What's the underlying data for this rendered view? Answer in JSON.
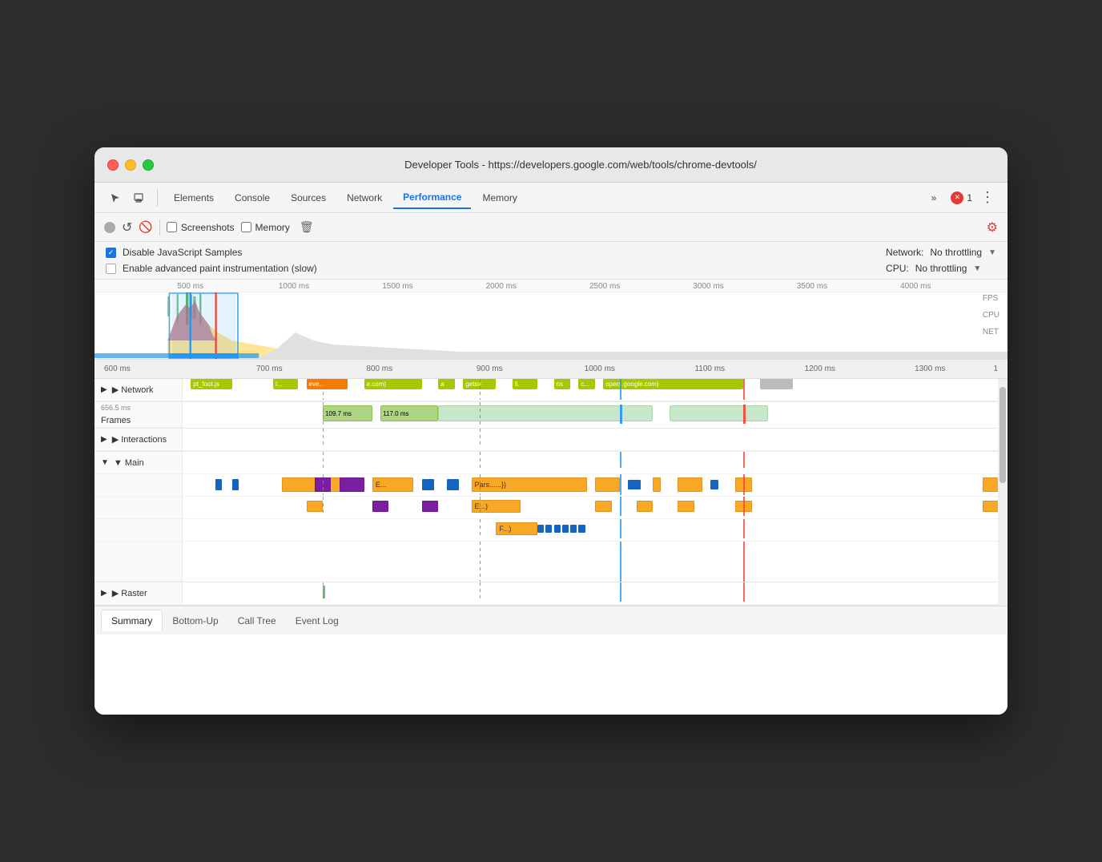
{
  "window": {
    "title": "Developer Tools - https://developers.google.com/web/tools/chrome-devtools/"
  },
  "tabs": {
    "items": [
      "Elements",
      "Console",
      "Sources",
      "Network",
      "Performance",
      "Memory"
    ],
    "active": "Performance",
    "more_label": "»",
    "error_count": "1"
  },
  "toolbar": {
    "record_label": "●",
    "refresh_label": "↺",
    "stop_label": "🚫",
    "screenshots_label": "Screenshots",
    "memory_label": "Memory",
    "trash_label": "🗑",
    "settings_label": "⚙"
  },
  "options": {
    "disable_js_samples": "Disable JavaScript Samples",
    "advanced_paint": "Enable advanced paint instrumentation (slow)",
    "network_label": "Network:",
    "network_value": "No throttling",
    "cpu_label": "CPU:",
    "cpu_value": "No throttling"
  },
  "overview": {
    "ruler_ticks": [
      "500 ms",
      "1000 ms",
      "1500 ms",
      "2000 ms",
      "2500 ms",
      "3000 ms",
      "3500 ms",
      "4000 ms"
    ],
    "right_labels": [
      "FPS",
      "CPU",
      "NET"
    ]
  },
  "zoom_ruler": {
    "ticks": [
      "600 ms",
      "700 ms",
      "800 ms",
      "900 ms",
      "1000 ms",
      "1100 ms",
      "1200 ms",
      "1300 ms",
      "1"
    ]
  },
  "tracks": {
    "network": {
      "label": "▶ Network",
      "items": [
        {
          "label": "pt_foot.js",
          "color": "#a5c800",
          "left": "2%",
          "width": "6%"
        },
        {
          "label": "l...",
          "color": "#a5c800",
          "left": "12%",
          "width": "4%"
        },
        {
          "label": "eve...",
          "color": "#f57c00",
          "left": "17%",
          "width": "6%"
        },
        {
          "label": "e.com)",
          "color": "#a5c800",
          "left": "25%",
          "width": "8%"
        },
        {
          "label": "a",
          "color": "#a5c800",
          "left": "35%",
          "width": "3%"
        },
        {
          "label": "getsuc",
          "color": "#a5c800",
          "left": "39%",
          "width": "5%"
        },
        {
          "label": "li.",
          "color": "#a5c800",
          "left": "45%",
          "width": "3%"
        },
        {
          "label": "ns",
          "color": "#a5c800",
          "left": "49%",
          "width": "2%"
        },
        {
          "label": "c...",
          "color": "#a5c800",
          "left": "52%",
          "width": "3%"
        },
        {
          "label": "opers.google.com)",
          "color": "#a5c800",
          "left": "56%",
          "width": "18%"
        },
        {
          "label": "",
          "color": "#bbb",
          "left": "76%",
          "width": "4%"
        }
      ]
    },
    "frames": {
      "label": "Frames",
      "note": "656.5 ms",
      "items": [
        {
          "label": "109.7 ms",
          "left": "17%",
          "width": "6%",
          "color": "#aed581"
        },
        {
          "label": "117.0 ms",
          "left": "24%",
          "width": "7%",
          "color": "#aed581"
        },
        {
          "label": "",
          "left": "31%",
          "width": "26%",
          "color": "#c8e6c9"
        },
        {
          "label": "",
          "left": "59%",
          "width": "12%",
          "color": "#c8e6c9"
        }
      ]
    },
    "interactions": {
      "label": "▶ Interactions"
    },
    "main": {
      "label": "▼ Main",
      "rows": [
        {
          "items": [
            {
              "label": "",
              "left": "4%",
              "width": "1%",
              "color": "#1565c0",
              "height": 12
            },
            {
              "label": "",
              "left": "6%",
              "width": "1%",
              "color": "#1565c0",
              "height": 12
            },
            {
              "label": "",
              "left": "10%",
              "width": "1%",
              "color": "#1565c0",
              "height": 12
            },
            {
              "label": "",
              "left": "12%",
              "width": "2%",
              "color": "#f9a825",
              "height": 18
            },
            {
              "label": "",
              "left": "15%",
              "width": "8%",
              "color": "#f9a825",
              "height": 18
            },
            {
              "label": "",
              "left": "16%",
              "width": "2%",
              "color": "#7b1fa2",
              "height": 18
            },
            {
              "label": "",
              "left": "19%",
              "width": "3%",
              "color": "#7b1fa2",
              "height": 18
            },
            {
              "label": "E...",
              "left": "23%",
              "width": "5%",
              "color": "#f9a825",
              "height": 18
            },
            {
              "label": "",
              "left": "29%",
              "width": "2%",
              "color": "#1565c0",
              "height": 14
            },
            {
              "label": "",
              "left": "32%",
              "width": "2%",
              "color": "#1565c0",
              "height": 14
            },
            {
              "label": "Pars......})",
              "left": "35%",
              "width": "14%",
              "color": "#f9a825",
              "height": 18
            },
            {
              "label": "",
              "left": "50%",
              "width": "3%",
              "color": "#f9a825",
              "height": 18
            },
            {
              "label": "",
              "left": "54%",
              "width": "2%",
              "color": "#1565c0",
              "height": 14
            },
            {
              "label": "",
              "left": "57%",
              "width": "1%",
              "color": "#f9a825",
              "height": 18
            },
            {
              "label": "",
              "left": "60%",
              "width": "3%",
              "color": "#f9a825",
              "height": 18
            },
            {
              "label": "",
              "left": "64%",
              "width": "1%",
              "color": "#1565c0",
              "height": 12
            },
            {
              "label": "",
              "left": "67%",
              "width": "2%",
              "color": "#f9a825",
              "height": 18
            },
            {
              "label": "",
              "left": "97%",
              "width": "2%",
              "color": "#f9a825",
              "height": 18
            }
          ]
        },
        {
          "items": [
            {
              "label": "",
              "left": "15%",
              "width": "2%",
              "color": "#f9a825",
              "height": 14
            },
            {
              "label": "",
              "left": "23%",
              "width": "2%",
              "color": "#7b1fa2",
              "height": 14
            },
            {
              "label": "",
              "left": "29%",
              "width": "2%",
              "color": "#7b1fa2",
              "height": 14
            },
            {
              "label": "E...)",
              "left": "35%",
              "width": "6%",
              "color": "#f9a825",
              "height": 16
            },
            {
              "label": "",
              "left": "50%",
              "width": "2%",
              "color": "#f9a825",
              "height": 14
            },
            {
              "label": "",
              "left": "55%",
              "width": "2%",
              "color": "#f9a825",
              "height": 14
            },
            {
              "label": "",
              "left": "60%",
              "width": "2%",
              "color": "#f9a825",
              "height": 14
            },
            {
              "label": "",
              "left": "67%",
              "width": "2%",
              "color": "#f9a825",
              "height": 14
            },
            {
              "label": "",
              "left": "97%",
              "width": "2%",
              "color": "#f9a825",
              "height": 14
            }
          ]
        },
        {
          "items": [
            {
              "label": "F...)",
              "left": "38%",
              "width": "5%",
              "color": "#f9a825",
              "height": 16
            },
            {
              "label": "",
              "left": "43%",
              "width": "1%",
              "color": "#1565c0",
              "height": 10
            },
            {
              "label": "",
              "left": "44%",
              "width": "1%",
              "color": "#1565c0",
              "height": 10
            },
            {
              "label": "",
              "left": "45%",
              "width": "1%",
              "color": "#1565c0",
              "height": 10
            },
            {
              "label": "",
              "left": "46%",
              "width": "1%",
              "color": "#1565c0",
              "height": 10
            }
          ]
        }
      ]
    },
    "raster": {
      "label": "▶ Raster"
    }
  },
  "bottom_tabs": {
    "items": [
      "Summary",
      "Bottom-Up",
      "Call Tree",
      "Event Log"
    ],
    "active": "Summary"
  },
  "colors": {
    "accent_blue": "#1a73e8",
    "tab_active_underline": "#1a73e8"
  }
}
